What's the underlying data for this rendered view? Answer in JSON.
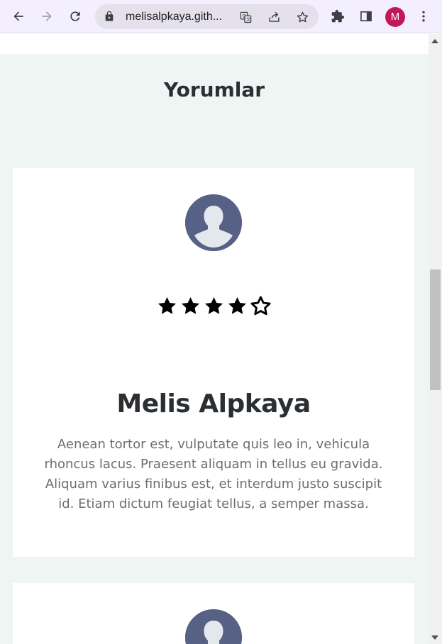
{
  "browser": {
    "url": "melisalpkaya.gith...",
    "profile_initial": "M",
    "icons": [
      "back-icon",
      "forward-icon",
      "reload-icon",
      "lock-icon",
      "translate-icon",
      "share-icon",
      "bookmark-star-icon",
      "extensions-icon",
      "side-panel-icon",
      "menu-kebab-icon"
    ],
    "colors": {
      "toolbar": "#f3efff",
      "omnibox": "#e4e1ec",
      "profile": "#c2185b"
    }
  },
  "page": {
    "section_title": "Yorumlar",
    "colors": {
      "section_background": "#eef5f2",
      "card_background": "#ffffff",
      "avatar": "#566185"
    },
    "reviews": [
      {
        "name": "Melis Alpkaya",
        "rating": 4,
        "max_rating": 5,
        "text": "Aenean tortor est, vulputate quis leo in, vehicula rhoncus lacus. Praesent aliquam in tellus eu gravida. Aliquam varius finibus est, et interdum justo suscipit id. Etiam dictum feugiat tellus, a semper massa."
      }
    ]
  },
  "scrollbar": {
    "position_fraction": 0.48
  }
}
